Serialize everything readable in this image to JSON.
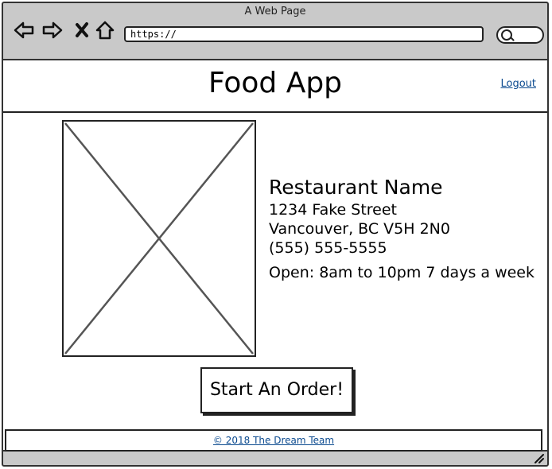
{
  "browser": {
    "window_title": "A Web Page",
    "url": "https://",
    "icons": [
      "back-icon",
      "forward-icon",
      "close-icon",
      "home-icon",
      "search-icon"
    ]
  },
  "header": {
    "app_title": "Food App",
    "logout_label": "Logout"
  },
  "restaurant": {
    "name": "Restaurant Name",
    "address_line1": "1234 Fake Street",
    "address_line2": "Vancouver, BC  V5H 2N0",
    "phone": "(555) 555-5555",
    "hours": "Open: 8am to 10pm 7 days a week"
  },
  "actions": {
    "start_order_label": "Start An Order!"
  },
  "footer": {
    "copyright": "© 2018 The Dream Team"
  }
}
